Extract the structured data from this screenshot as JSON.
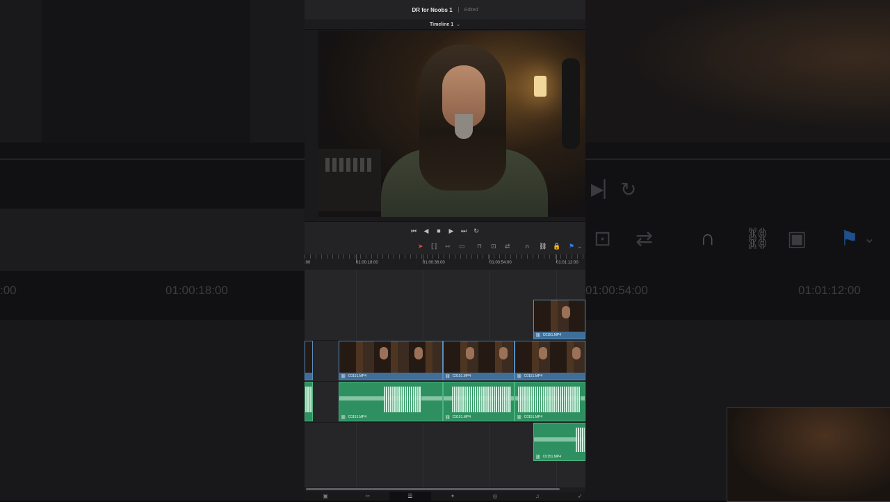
{
  "app": {
    "project_title": "DR for Noobs 1",
    "status": "Edited",
    "timeline_name": "Timeline 1"
  },
  "transport": {
    "buttons": [
      {
        "name": "first-frame-icon",
        "glyph": "⏮"
      },
      {
        "name": "reverse-icon",
        "glyph": "◀"
      },
      {
        "name": "stop-icon",
        "glyph": "■"
      },
      {
        "name": "play-icon",
        "glyph": "▶"
      },
      {
        "name": "last-frame-icon",
        "glyph": "⏭"
      },
      {
        "name": "loop-icon",
        "glyph": "↻"
      }
    ]
  },
  "toolbar": {
    "tools": [
      {
        "name": "selection-tool-icon",
        "glyph": "➤",
        "color": "#e0483a"
      },
      {
        "name": "trim-tool-icon",
        "glyph": "⟦⟧",
        "color": "#8a8a8a"
      },
      {
        "name": "dynamic-trim-icon",
        "glyph": "⇿",
        "color": "#8a8a8a"
      },
      {
        "name": "blade-tool-icon",
        "glyph": "▭",
        "color": "#8a8a8a"
      },
      {
        "name": "insert-clip-icon",
        "glyph": "⊓",
        "color": "#8a8a8a"
      },
      {
        "name": "overwrite-clip-icon",
        "glyph": "⊡",
        "color": "#8a8a8a"
      },
      {
        "name": "replace-clip-icon",
        "glyph": "⇄",
        "color": "#8a8a8a"
      },
      {
        "name": "snapping-icon",
        "glyph": "∩",
        "color": "#e6e6e6"
      },
      {
        "name": "linked-selection-icon",
        "glyph": "⛓",
        "color": "#e6e6e6"
      },
      {
        "name": "position-lock-icon",
        "glyph": "🔒",
        "color": "#8a8a8a"
      },
      {
        "name": "flag-icon",
        "glyph": "⚑",
        "color": "#2f7fe0"
      },
      {
        "name": "flag-dropdown-icon",
        "glyph": "⌄",
        "color": "#8a8a8a"
      }
    ]
  },
  "ruler": {
    "start_label": ":00",
    "timecodes": [
      "01:00:18:00",
      "01:00:36:00",
      "01:00:54:00",
      "01:01:12:00"
    ]
  },
  "clips": {
    "video_upper": {
      "label": "C0151.MP4"
    },
    "video_main": [
      {
        "label": "C0151.MP4"
      },
      {
        "label": "C0151.MP4"
      },
      {
        "label": "C0151.MP4"
      }
    ],
    "audio_main": [
      {
        "label": "C0151.MP4"
      },
      {
        "label": "C0151.MP4"
      },
      {
        "label": "C0151.MP4"
      }
    ],
    "audio_lower": {
      "label": "C0151.MP4"
    }
  },
  "pages_nav": [
    {
      "name": "media-page-icon",
      "glyph": "▣",
      "active": false
    },
    {
      "name": "cut-page-icon",
      "glyph": "✂",
      "active": false
    },
    {
      "name": "edit-page-icon",
      "glyph": "☰",
      "active": true
    },
    {
      "name": "fusion-page-icon",
      "glyph": "✦",
      "active": false
    },
    {
      "name": "color-page-icon",
      "glyph": "◎",
      "active": false
    },
    {
      "name": "fairlight-page-icon",
      "glyph": "♫",
      "active": false
    },
    {
      "name": "deliver-page-icon",
      "glyph": "➶",
      "active": false
    }
  ],
  "background": {
    "timecodes_left": [
      ":00",
      "01:00:18:00"
    ],
    "timecodes_right": [
      "01:00:54:00",
      "01:01:12:00"
    ]
  }
}
